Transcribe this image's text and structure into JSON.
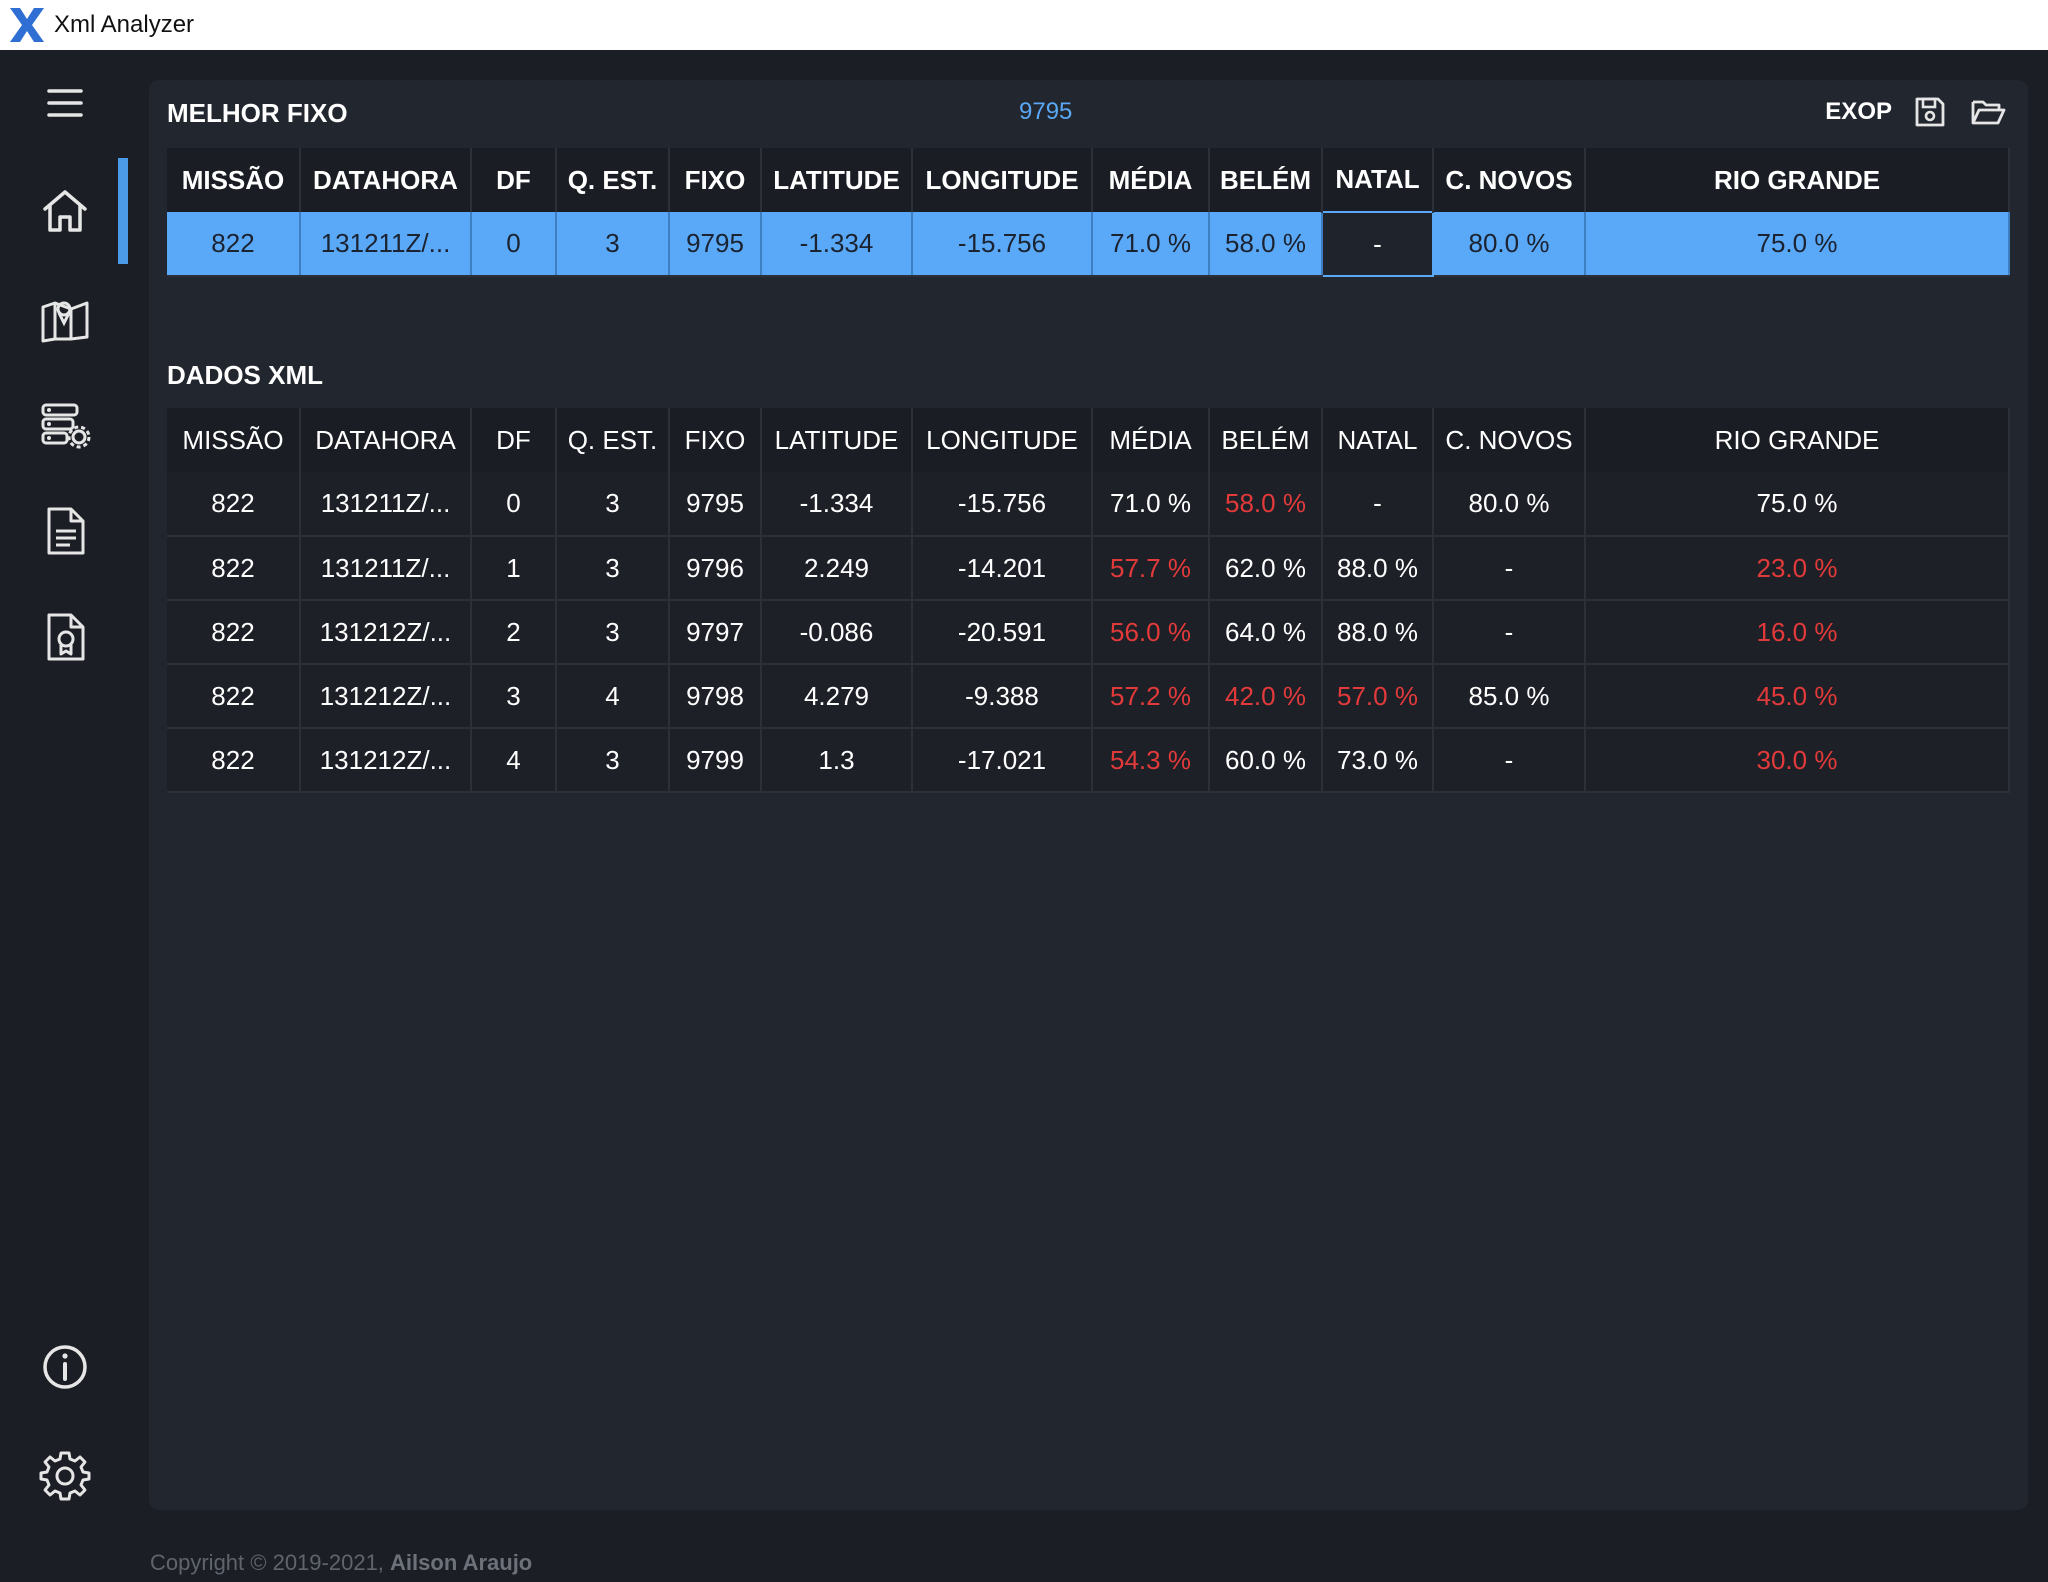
{
  "app": {
    "title": "Xml Analyzer"
  },
  "sidebar": {
    "items": [
      {
        "icon": "menu-icon"
      },
      {
        "icon": "home-icon",
        "active": true
      },
      {
        "icon": "map-icon"
      },
      {
        "icon": "server-settings-icon"
      },
      {
        "icon": "document-icon"
      },
      {
        "icon": "certificate-icon"
      },
      {
        "icon": "info-icon"
      },
      {
        "icon": "gear-icon"
      }
    ]
  },
  "columns": [
    "MISSÃO",
    "DATAHORA",
    "DF",
    "Q. EST.",
    "FIXO",
    "LATITUDE",
    "LONGITUDE",
    "MÉDIA",
    "BELÉM",
    "NATAL",
    "C. NOVOS",
    "RIO GRANDE"
  ],
  "best_fix": {
    "title": "MELHOR FIXO",
    "value": "9795",
    "exop_label": "EXOP",
    "row": [
      "822",
      "131211Z/...",
      "0",
      "3",
      "9795",
      "-1.334",
      "-15.756",
      "71.0 %",
      "58.0 %",
      "-",
      "80.0 %",
      "75.0 %"
    ]
  },
  "xml_data": {
    "title": "DADOS XML",
    "rows": [
      [
        "822",
        "131211Z/...",
        "0",
        "3",
        "9795",
        "-1.334",
        "-15.756",
        "71.0 %",
        "58.0 %",
        "-",
        "80.0 %",
        "75.0 %"
      ],
      [
        "822",
        "131211Z/...",
        "1",
        "3",
        "9796",
        "2.249",
        "-14.201",
        "57.7 %",
        "62.0 %",
        "88.0 %",
        "-",
        "23.0 %"
      ],
      [
        "822",
        "131212Z/...",
        "2",
        "3",
        "9797",
        "-0.086",
        "-20.591",
        "56.0 %",
        "64.0 %",
        "88.0 %",
        "-",
        "16.0 %"
      ],
      [
        "822",
        "131212Z/...",
        "3",
        "4",
        "9798",
        "4.279",
        "-9.388",
        "57.2 %",
        "42.0 %",
        "57.0 %",
        "85.0 %",
        "45.0 %"
      ],
      [
        "822",
        "131212Z/...",
        "4",
        "3",
        "9799",
        "1.3",
        "-17.021",
        "54.3 %",
        "60.0 %",
        "73.0 %",
        "-",
        "30.0 %"
      ]
    ],
    "low_values": [
      [
        false,
        false,
        false,
        false,
        false,
        false,
        false,
        false,
        true,
        false,
        false,
        false
      ],
      [
        false,
        false,
        false,
        false,
        false,
        false,
        false,
        true,
        false,
        false,
        false,
        true
      ],
      [
        false,
        false,
        false,
        false,
        false,
        false,
        false,
        true,
        false,
        false,
        false,
        true
      ],
      [
        false,
        false,
        false,
        false,
        false,
        false,
        false,
        true,
        true,
        true,
        false,
        true
      ],
      [
        false,
        false,
        false,
        false,
        false,
        false,
        false,
        true,
        false,
        false,
        false,
        true
      ]
    ]
  },
  "footer": {
    "prefix": "Copyright © 2019-2021,",
    "author": "Ailson Araujo"
  },
  "colors": {
    "accent": "#5aa9f8",
    "bad": "#e23a3a",
    "panel": "#22262f"
  }
}
